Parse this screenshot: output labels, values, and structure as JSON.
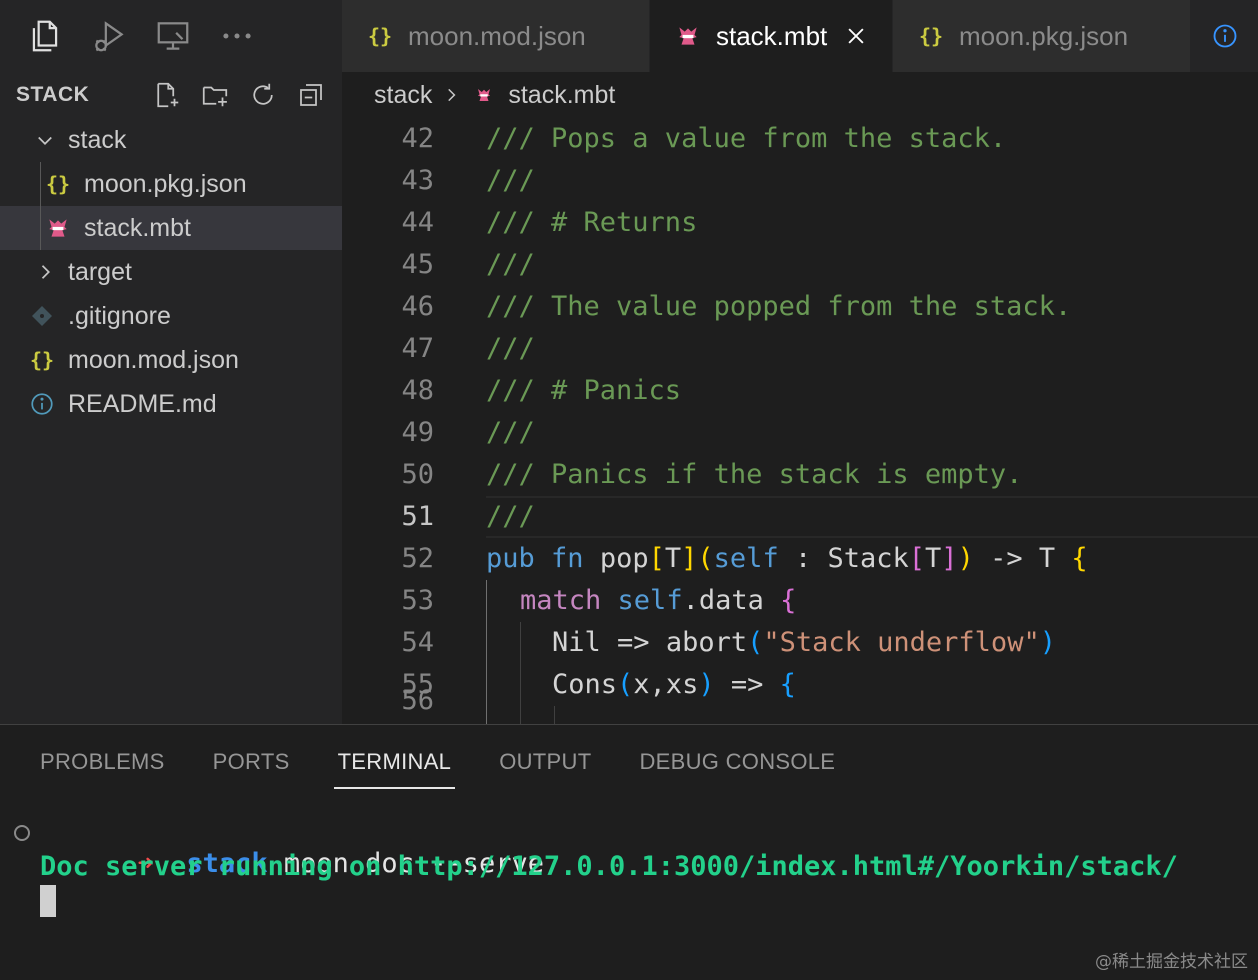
{
  "tabs": [
    {
      "label": "moon.mod.json",
      "icon": "json-icon",
      "active": false
    },
    {
      "label": "stack.mbt",
      "icon": "moonbit-icon",
      "active": true
    },
    {
      "label": "moon.pkg.json",
      "icon": "json-icon",
      "active": false
    }
  ],
  "sidebar": {
    "title": "STACK",
    "items": [
      {
        "label": "stack",
        "kind": "folder-open"
      },
      {
        "label": "moon.pkg.json",
        "kind": "json"
      },
      {
        "label": "stack.mbt",
        "kind": "moonbit",
        "selected": true
      },
      {
        "label": "target",
        "kind": "folder-closed"
      },
      {
        "label": ".gitignore",
        "kind": "git"
      },
      {
        "label": "moon.mod.json",
        "kind": "json"
      },
      {
        "label": "README.md",
        "kind": "info"
      }
    ]
  },
  "breadcrumb": {
    "folder": "stack",
    "file": "stack.mbt"
  },
  "editor": {
    "line_numbers": [
      "42",
      "43",
      "44",
      "45",
      "46",
      "47",
      "48",
      "49",
      "50",
      "51",
      "52",
      "53",
      "54",
      "55",
      "56"
    ],
    "current_line": "51",
    "comments": [
      "/// Pops a value from the stack.",
      "///",
      "/// # Returns",
      "///",
      "/// The value popped from the stack.",
      "///",
      "/// # Panics",
      "///",
      "/// Panics if the stack is empty.",
      "///"
    ],
    "code52": {
      "pub": "pub",
      "fn": "fn",
      "name": "pop",
      "lb": "[",
      "T1": "T",
      "rb": "]",
      "lp": "(",
      "self": "self",
      "colon": " : ",
      "type": "Stack",
      "lb2": "[",
      "T2": "T",
      "rb2": "]",
      "rp": ")",
      "arrow": " -> ",
      "ret": "T",
      "brace": "{"
    },
    "code53": {
      "match": "match",
      "self": "self",
      "field": ".data",
      "brace": "{"
    },
    "code54": {
      "ctor": "Nil",
      "arrow": " => ",
      "fn": "abort",
      "lp": "(",
      "str": "\"Stack underflow\"",
      "rp": ")"
    },
    "code55": {
      "ctor": "Cons",
      "lp": "(",
      "args": "x,xs",
      "rp": ")",
      "arrow": " => ",
      "brace": "{"
    }
  },
  "panel": {
    "tabs": [
      "PROBLEMS",
      "PORTS",
      "TERMINAL",
      "OUTPUT",
      "DEBUG CONSOLE"
    ],
    "active_tab": "TERMINAL",
    "terminal": {
      "prompt_arrow": "➜",
      "dir": "stack",
      "command": "moon doc --serve",
      "output": "Doc server running on http://127.0.0.1:3000/index.html#/Yoorkin/stack/"
    }
  },
  "watermark": "@稀土掘金技术社区",
  "colors": {
    "accent": "#3b8eea",
    "success": "#23d18b",
    "error": "#f14c4c",
    "comment": "#6a9955",
    "keyword": "#569cd6"
  }
}
